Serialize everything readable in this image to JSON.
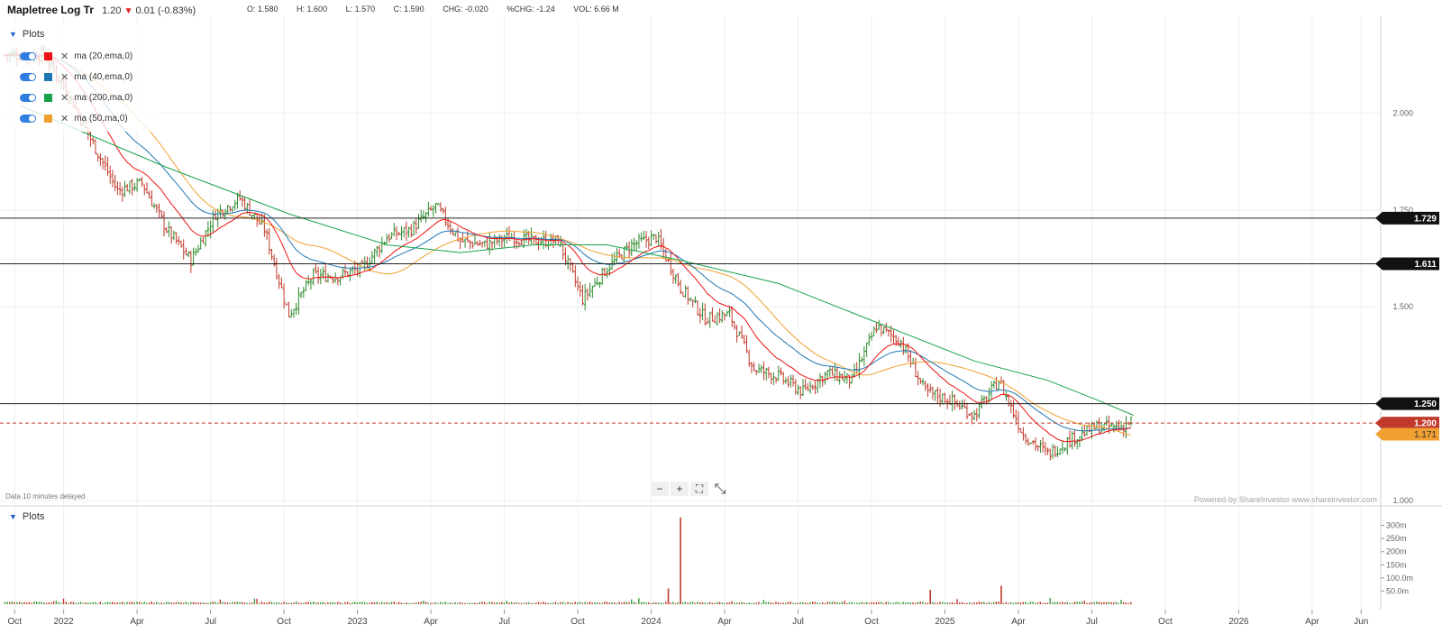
{
  "header": {
    "title": "Mapletree Log Tr",
    "last": "1.20",
    "change": "0.01 (-0.83%)",
    "ohlc": [
      "O: 1.580",
      "H: 1.600",
      "L: 1.570",
      "C: 1.590",
      "CHG: -0.020",
      "%CHG: -1.24",
      "VOL: 6.66 M"
    ]
  },
  "plots_panel": {
    "label": "Plots",
    "items": [
      {
        "label": "ma (20,ema,0)",
        "color": "#ee1111"
      },
      {
        "label": "ma (40,ema,0)",
        "color": "#1f77b4"
      },
      {
        "label": "ma (200,ma,0)",
        "color": "#17a34a"
      },
      {
        "label": "ma (50,ma,0)",
        "color": "#f0a030"
      }
    ]
  },
  "volume_panel": {
    "label": "Plots"
  },
  "footer": {
    "delayed": "Data 10 minutes delayed",
    "powered": "Powered by ShareInvestor www.shareinvestor.com"
  },
  "toolbar": {
    "zoom_out": "−",
    "zoom_in": "+",
    "fit": "⛶",
    "expand": "⤡"
  },
  "chart_data": {
    "type": "candlestick",
    "x_ticks": [
      {
        "label": "Oct",
        "t": -1.2
      },
      {
        "label": "2022",
        "t": 0.8
      },
      {
        "label": "Apr",
        "t": 3.8
      },
      {
        "label": "Jul",
        "t": 6.8
      },
      {
        "label": "Oct",
        "t": 9.8
      },
      {
        "label": "2023",
        "t": 12.8
      },
      {
        "label": "Apr",
        "t": 15.8
      },
      {
        "label": "Jul",
        "t": 18.8
      },
      {
        "label": "Oct",
        "t": 21.8
      },
      {
        "label": "2024",
        "t": 24.8
      },
      {
        "label": "Apr",
        "t": 27.8
      },
      {
        "label": "Jul",
        "t": 30.8
      },
      {
        "label": "Oct",
        "t": 33.8
      },
      {
        "label": "2025",
        "t": 36.8
      },
      {
        "label": "Apr",
        "t": 39.8
      },
      {
        "label": "Jul",
        "t": 42.8
      },
      {
        "label": "Oct",
        "t": 45.8
      },
      {
        "label": "2026",
        "t": 48.8
      },
      {
        "label": "Apr",
        "t": 51.8
      },
      {
        "label": "Jun",
        "t": 53.8
      }
    ],
    "y_axis": {
      "min": 1.0,
      "max": 2.25,
      "ticks": [
        1.0,
        1.25,
        1.5,
        1.75,
        2.0
      ],
      "tick_labels": [
        "1.000",
        "1.250",
        "1.500",
        "1.750",
        "2.000"
      ]
    },
    "horizontal_lines": [
      {
        "value": 1.729,
        "label": "1.729"
      },
      {
        "value": 1.611,
        "label": "1.611"
      },
      {
        "value": 1.25,
        "label": "1.250"
      }
    ],
    "last_price": {
      "value": 1.2,
      "label": "1.200",
      "color": "#c0392b"
    },
    "ma_last": {
      "value": 1.171,
      "label": "1.171",
      "color": "#f0a030"
    },
    "price_path": [
      {
        "t": 0,
        "v": 2.15
      },
      {
        "t": 1,
        "v": 2.05
      },
      {
        "t": 2,
        "v": 1.92
      },
      {
        "t": 3,
        "v": 1.8
      },
      {
        "t": 4,
        "v": 1.82
      },
      {
        "t": 5,
        "v": 1.7
      },
      {
        "t": 6,
        "v": 1.62
      },
      {
        "t": 7,
        "v": 1.74
      },
      {
        "t": 8,
        "v": 1.78
      },
      {
        "t": 9,
        "v": 1.7
      },
      {
        "t": 10,
        "v": 1.48
      },
      {
        "t": 11,
        "v": 1.58
      },
      {
        "t": 12,
        "v": 1.58
      },
      {
        "t": 13,
        "v": 1.6
      },
      {
        "t": 14,
        "v": 1.68
      },
      {
        "t": 15,
        "v": 1.7
      },
      {
        "t": 16,
        "v": 1.76
      },
      {
        "t": 17,
        "v": 1.67
      },
      {
        "t": 18,
        "v": 1.66
      },
      {
        "t": 19,
        "v": 1.68
      },
      {
        "t": 20,
        "v": 1.67
      },
      {
        "t": 21,
        "v": 1.67
      },
      {
        "t": 22,
        "v": 1.52
      },
      {
        "t": 23,
        "v": 1.6
      },
      {
        "t": 24,
        "v": 1.66
      },
      {
        "t": 25,
        "v": 1.68
      },
      {
        "t": 26,
        "v": 1.55
      },
      {
        "t": 27,
        "v": 1.47
      },
      {
        "t": 28,
        "v": 1.48
      },
      {
        "t": 29,
        "v": 1.34
      },
      {
        "t": 30,
        "v": 1.32
      },
      {
        "t": 31,
        "v": 1.28
      },
      {
        "t": 32,
        "v": 1.33
      },
      {
        "t": 33,
        "v": 1.31
      },
      {
        "t": 34,
        "v": 1.45
      },
      {
        "t": 35,
        "v": 1.41
      },
      {
        "t": 36,
        "v": 1.28
      },
      {
        "t": 37,
        "v": 1.26
      },
      {
        "t": 38,
        "v": 1.22
      },
      {
        "t": 39,
        "v": 1.31
      },
      {
        "t": 40,
        "v": 1.17
      },
      {
        "t": 41,
        "v": 1.12
      },
      {
        "t": 42,
        "v": 1.16
      },
      {
        "t": 43,
        "v": 1.19
      },
      {
        "t": 44,
        "v": 1.19
      },
      {
        "t": 44.5,
        "v": 1.21
      }
    ],
    "ma200": [
      {
        "t": -1,
        "v": 2.02
      },
      {
        "t": 5,
        "v": 1.86
      },
      {
        "t": 10,
        "v": 1.74
      },
      {
        "t": 14,
        "v": 1.66
      },
      {
        "t": 17,
        "v": 1.64
      },
      {
        "t": 20,
        "v": 1.66
      },
      {
        "t": 23,
        "v": 1.66
      },
      {
        "t": 26,
        "v": 1.62
      },
      {
        "t": 30,
        "v": 1.56
      },
      {
        "t": 34,
        "v": 1.46
      },
      {
        "t": 38,
        "v": 1.36
      },
      {
        "t": 41,
        "v": 1.31
      },
      {
        "t": 43,
        "v": 1.26
      },
      {
        "t": 44.5,
        "v": 1.22
      }
    ],
    "volume_axis": {
      "max": 350,
      "tick_labels": [
        "50.0m",
        "100.0m",
        "150m",
        "200m",
        "250m",
        "300m"
      ],
      "ticks": [
        50,
        100,
        150,
        200,
        250,
        300
      ]
    },
    "volume_spikes": [
      {
        "t": 26.0,
        "v": 330
      },
      {
        "t": 25.5,
        "v": 60
      },
      {
        "t": 39.1,
        "v": 70
      },
      {
        "t": 36.2,
        "v": 55
      }
    ]
  }
}
